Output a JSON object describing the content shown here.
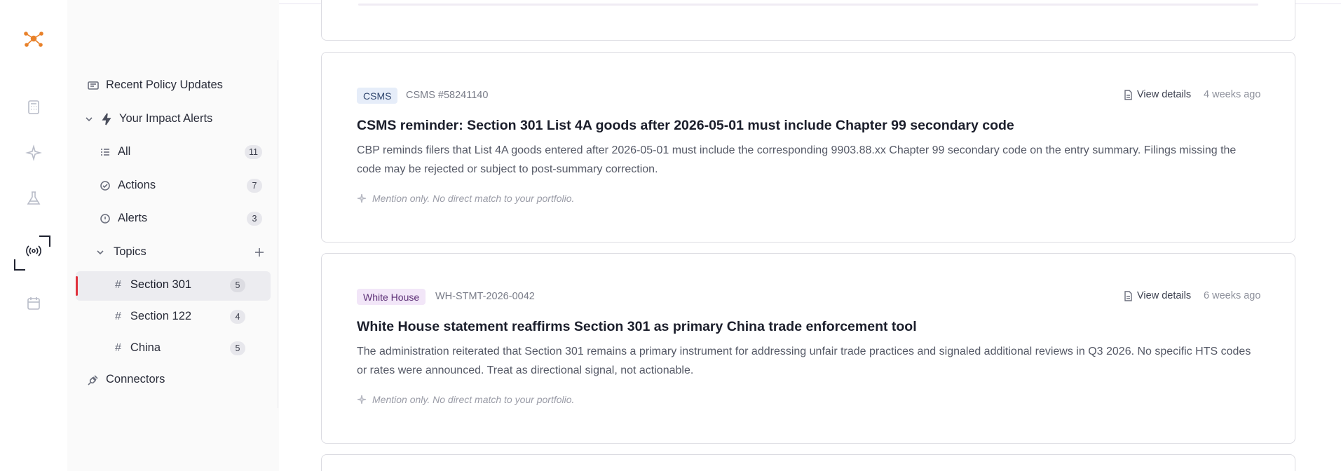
{
  "sidebar": {
    "recent": "Recent Policy Updates",
    "impact": "Your Impact Alerts",
    "all": {
      "label": "All",
      "count": "11"
    },
    "actions": {
      "label": "Actions",
      "count": "7"
    },
    "alerts": {
      "label": "Alerts",
      "count": "3"
    },
    "topics": "Topics",
    "topic_items": [
      {
        "label": "Section 301",
        "count": "5"
      },
      {
        "label": "Section 122",
        "count": "4"
      },
      {
        "label": "China",
        "count": "5"
      }
    ],
    "connectors": "Connectors"
  },
  "cards": [
    {
      "tag": "CSMS",
      "ref": "CSMS #58241140",
      "view": "View details",
      "ago": "4 weeks ago",
      "title": "CSMS reminder: Section 301 List 4A goods after 2026-05-01 must include Chapter 99 secondary code",
      "body": "CBP reminds filers that List 4A goods entered after 2026-05-01 must include the corresponding 9903.88.xx Chapter 99 secondary code on the entry summary. Filings missing the code may be rejected or subject to post-summary correction.",
      "mention": "Mention only. No direct match to your portfolio."
    },
    {
      "tag": "White House",
      "ref": "WH-STMT-2026-0042",
      "view": "View details",
      "ago": "6 weeks ago",
      "title": "White House statement reaffirms Section 301 as primary China trade enforcement tool",
      "body": "The administration reiterated that Section 301 remains a primary instrument for addressing unfair trade practices and signaled additional reviews in Q3 2026. No specific HTS codes or rates were announced. Treat as directional signal, not actionable.",
      "mention": "Mention only. No direct match to your portfolio."
    }
  ],
  "colors": {
    "accent_logo": "#e8812a",
    "active_marker": "#e0323d"
  },
  "icons": [
    "network-logo-icon",
    "calculator-icon",
    "sparkle-icon",
    "flask-icon",
    "broadcast-icon",
    "calendar-icon"
  ]
}
